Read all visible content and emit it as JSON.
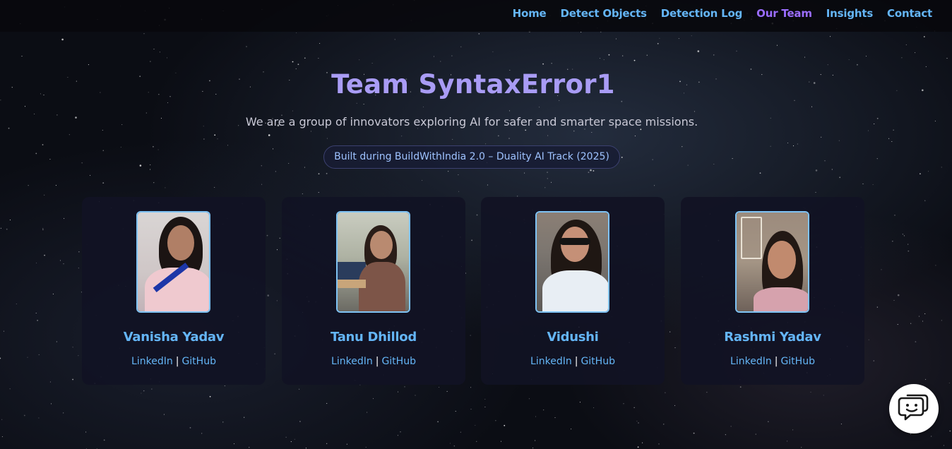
{
  "nav": {
    "items": [
      {
        "label": "Home",
        "active": false
      },
      {
        "label": "Detect Objects",
        "active": false
      },
      {
        "label": "Detection Log",
        "active": false
      },
      {
        "label": "Our Team",
        "active": true
      },
      {
        "label": "Insights",
        "active": false
      },
      {
        "label": "Contact",
        "active": false
      }
    ]
  },
  "hero": {
    "title": "Team SyntaxError1",
    "subtitle": "We are a group of innovators exploring AI for safer and smarter space missions.",
    "badge": "Built during BuildWithIndia 2.0 – Duality AI Track (2025)"
  },
  "team": [
    {
      "name": "Vanisha Yadav",
      "linkedin": "LinkedIn",
      "separator": "|",
      "github": "GitHub"
    },
    {
      "name": "Tanu Dhillod",
      "linkedin": "LinkedIn",
      "separator": "|",
      "github": "GitHub"
    },
    {
      "name": "Vidushi",
      "linkedin": "LinkedIn",
      "separator": "|",
      "github": "GitHub"
    },
    {
      "name": "Rashmi Yadav",
      "linkedin": "LinkedIn",
      "separator": "|",
      "github": "GitHub"
    }
  ],
  "colors": {
    "link": "#64b5f6",
    "active": "#9b6dff",
    "title": "#a99cf5",
    "card": "#111224"
  },
  "icons": {
    "chat": "chat-bot-icon"
  }
}
